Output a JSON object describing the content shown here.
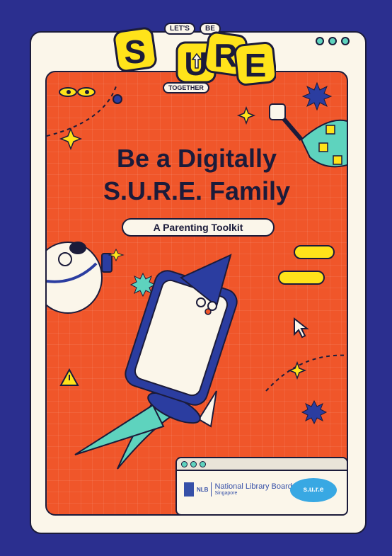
{
  "logo": {
    "top_text_1": "LET'S",
    "top_text_2": "BE",
    "letters": [
      "S",
      "U",
      "R",
      "E"
    ],
    "bottom_text": "TOGETHER"
  },
  "title_line_1": "Be a Digitally",
  "title_line_2": "S.U.R.E. Family",
  "subtitle": "A Parenting Toolkit",
  "footer": {
    "nlb_abbr": "NLB",
    "org_name": "National Library Board",
    "org_country": "Singapore",
    "sure_badge": "s.u.r.e"
  },
  "colors": {
    "background": "#2b2f8f",
    "poster": "#f0562a",
    "cream": "#fbf6ea",
    "accent_teal": "#5ed3be",
    "accent_yellow": "#ffe31a",
    "rocket_blue": "#2b3da0"
  }
}
